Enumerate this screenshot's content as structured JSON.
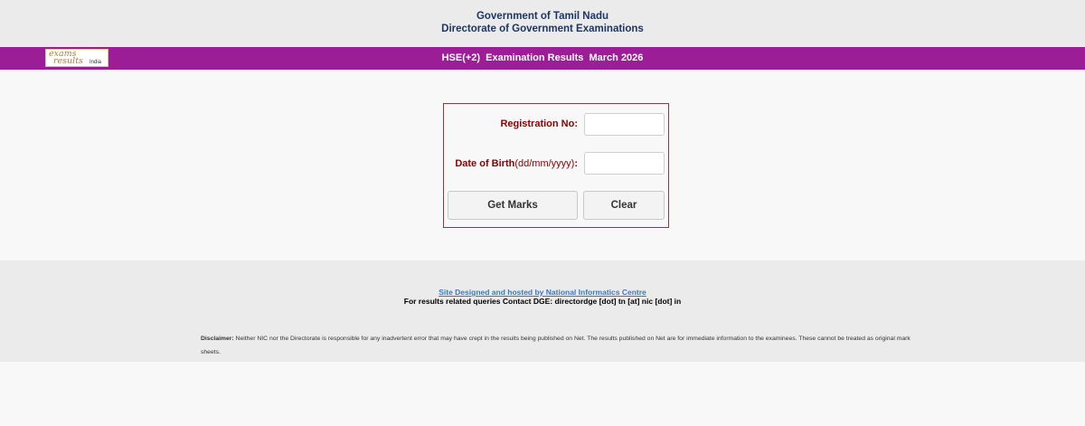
{
  "header": {
    "line1": "Government of Tamil Nadu",
    "line2": "Directorate of Government Examinations"
  },
  "banner": {
    "logo": {
      "exams": "exams",
      "results": "results",
      "india": "India"
    },
    "title": "HSE(+2)  Examination Results  March 2026",
    "background_color": "#9b1e96"
  },
  "form": {
    "registration_label": "Registration No:",
    "registration_value": "",
    "dob_label": "Date of Birth",
    "dob_format": "(dd/mm/yyyy)",
    "dob_colon": ":",
    "dob_value": "",
    "get_marks_label": "Get Marks",
    "clear_label": "Clear"
  },
  "footer": {
    "credit_link": "Site Designed and hosted by National Informatics Centre",
    "contact": "For results related queries Contact DGE:  directordge [dot] tn [at] nic [dot] in",
    "disclaimer_label": "Disclaimer:",
    "disclaimer_text": " Neither NIC nor the Directorate is responsible for any inadvertent error that may have crept in the results being published on Net. The results published on Net are for immediate information to the examinees. These cannot be treated as original mark sheets."
  }
}
